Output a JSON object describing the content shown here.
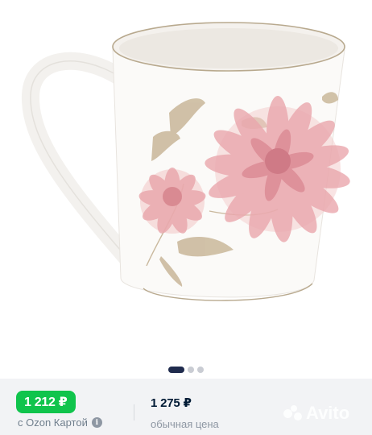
{
  "product": {
    "image_alt": "mug-with-chrysanthemum-print",
    "gallery": {
      "total_slides": 3,
      "active_index": 0
    }
  },
  "pricing": {
    "ozon_price": "1 212 ₽",
    "ozon_caption": "с Ozon Картой",
    "regular_price": "1 275 ₽",
    "regular_caption": "обычная цена"
  },
  "watermark": {
    "text": "Avito"
  },
  "colors": {
    "ozon_green": "#10c44c",
    "active_dot": "#1f2b4d",
    "inactive_dot": "#c9ccd3",
    "panel_bg": "#f2f3f5"
  },
  "icons": {
    "info": "info-icon",
    "watermark_logo": "avito-logo-icon"
  }
}
